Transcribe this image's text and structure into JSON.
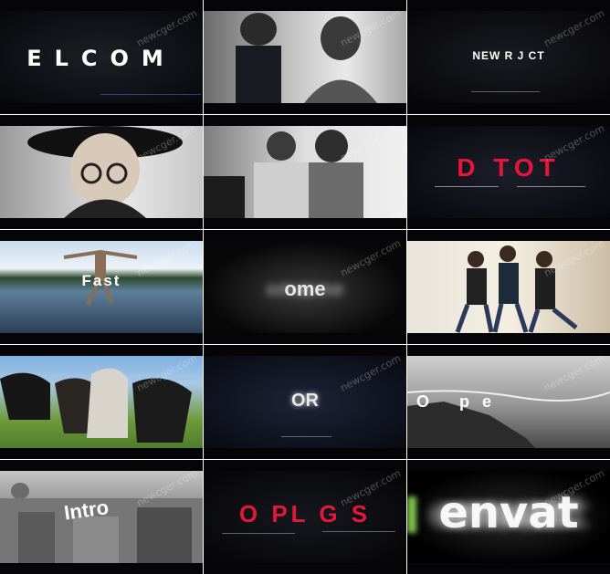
{
  "watermark": "newcger.com",
  "tiles": [
    {
      "id": 1,
      "caption": "ELCOM"
    },
    {
      "id": 2,
      "caption": ""
    },
    {
      "id": 3,
      "caption": "NEW R J CT"
    },
    {
      "id": 4,
      "caption": ""
    },
    {
      "id": 5,
      "caption": ""
    },
    {
      "id": 6,
      "caption": "D TOT"
    },
    {
      "id": 7,
      "caption": "Fast"
    },
    {
      "id": 8,
      "caption": "ome"
    },
    {
      "id": 9,
      "caption": ""
    },
    {
      "id": 10,
      "caption": ""
    },
    {
      "id": 11,
      "caption": "OR"
    },
    {
      "id": 12,
      "caption": "O pe"
    },
    {
      "id": 13,
      "caption": "Intro"
    },
    {
      "id": 14,
      "caption": "O PL G S"
    },
    {
      "id": 15,
      "caption": "envat"
    }
  ],
  "colors": {
    "accent_red": "#e3173a",
    "dark": "#0b0c10"
  }
}
